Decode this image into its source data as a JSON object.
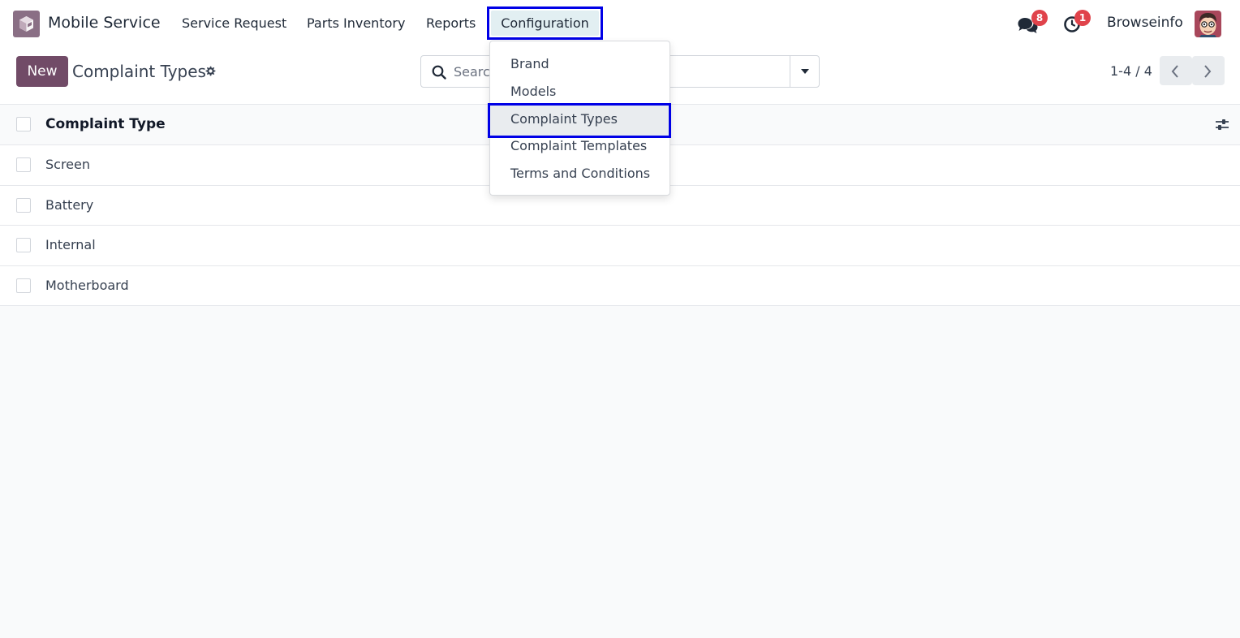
{
  "navbar": {
    "app_name": "Mobile Service",
    "menu": [
      "Service Request",
      "Parts Inventory",
      "Reports",
      "Configuration"
    ],
    "active_menu": "Configuration",
    "chat_badge": "8",
    "activity_badge": "1",
    "user_name": "Browseinfo"
  },
  "control_panel": {
    "new_label": "New",
    "title": "Complaint Types",
    "search_placeholder": "Search...",
    "pager_value": "1-4 / 4"
  },
  "list": {
    "column": "Complaint Type",
    "rows": [
      "Screen",
      "Battery",
      "Internal",
      "Motherboard"
    ]
  },
  "dropdown": {
    "items": [
      "Brand",
      "Models",
      "Complaint Types",
      "Complaint Templates",
      "Terms and Conditions"
    ],
    "selected": "Complaint Types"
  },
  "colors": {
    "brand": "#714b67",
    "highlight_border": "#0000e6",
    "badge": "#e0434b"
  }
}
